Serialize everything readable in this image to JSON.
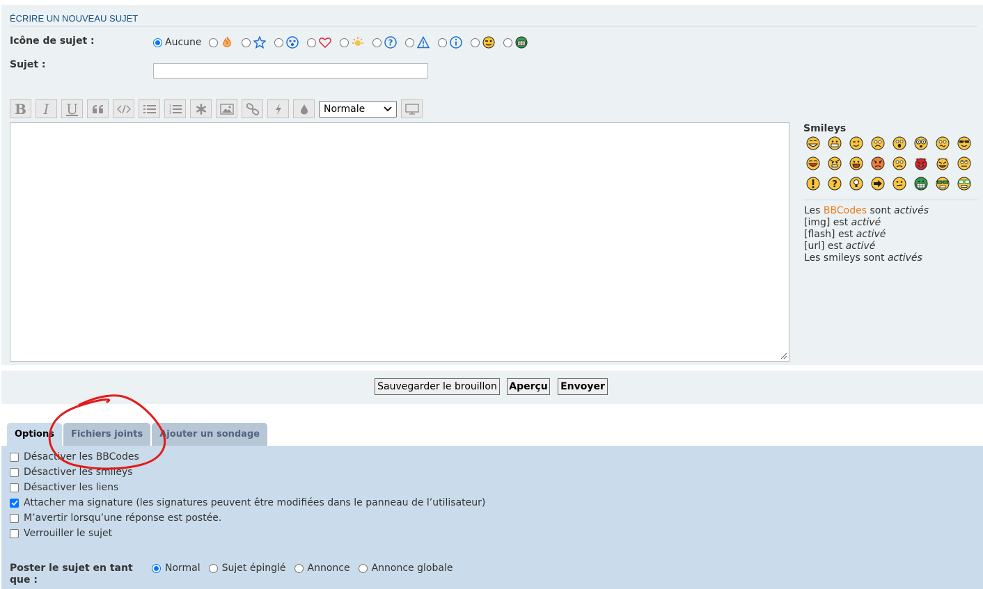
{
  "section": {
    "heading": "ÉCRIRE UN NOUVEAU SUJET"
  },
  "topic_icon": {
    "label": "Icône de sujet :",
    "none_label": "Aucune",
    "icons": [
      "fire-icon",
      "star-icon",
      "shock-icon",
      "heart-icon",
      "sun-icon",
      "question-icon",
      "warning-icon",
      "info-icon",
      "wink-smiley-icon",
      "grin-smiley-icon"
    ]
  },
  "subject": {
    "label": "Sujet :",
    "value": ""
  },
  "toolbar": {
    "buttons": [
      "bold",
      "italic",
      "underline",
      "quote",
      "code",
      "list",
      "list-numbered",
      "list-item",
      "image",
      "link",
      "flash",
      "color"
    ],
    "font_size": "Normale"
  },
  "smileys": {
    "title": "Smileys",
    "rows": [
      [
        "very-happy",
        "smile",
        "wink",
        "sad",
        "surprised",
        "shocked",
        "confused",
        "cool"
      ],
      [
        "laughing",
        "mad",
        "razz",
        "embarrassed",
        "crying",
        "evil",
        "twisted",
        "rolleyes"
      ],
      [
        "exclaim",
        "question",
        "idea",
        "arrow",
        "neutral",
        "mr-green",
        "geek",
        "uber-geek"
      ]
    ]
  },
  "bbcode_info": {
    "line1_prefix": "Les ",
    "line1_link": "BBCodes",
    "line1_mid": " sont ",
    "line1_state": "activés",
    "line2_prefix": "[img] est ",
    "line2_state": "activé",
    "line3_prefix": "[flash] est ",
    "line3_state": "activé",
    "line4_prefix": "[url] est ",
    "line4_state": "activé",
    "line5_prefix": "Les smileys sont ",
    "line5_state": "activés"
  },
  "actions": {
    "save_draft": "Sauvegarder le brouillon",
    "preview": "Aperçu",
    "submit": "Envoyer"
  },
  "tabs": [
    "Options",
    "Fichiers joints",
    "Ajouter un sondage"
  ],
  "options": [
    {
      "label": "Désactiver les BBCodes",
      "checked": false
    },
    {
      "label": "Désactiver les smileys",
      "checked": false
    },
    {
      "label": "Désactiver les liens",
      "checked": false
    },
    {
      "label": "Attacher ma signature (les signatures peuvent être modifiées dans le panneau de l’utilisateur)",
      "checked": true
    },
    {
      "label": "M’avertir lorsqu’une réponse est postée.",
      "checked": false
    },
    {
      "label": "Verrouiller le sujet",
      "checked": false
    }
  ],
  "post_as": {
    "label": "Poster le sujet en tant que :",
    "choices": [
      "Normal",
      "Sujet épinglé",
      "Annonce",
      "Annonce globale"
    ],
    "selected": "Normal"
  },
  "colors": {
    "accent": "#0075ff",
    "heading": "#105289",
    "bbcode_link": "#EC7B1C",
    "annotation": "#e31b1b"
  }
}
